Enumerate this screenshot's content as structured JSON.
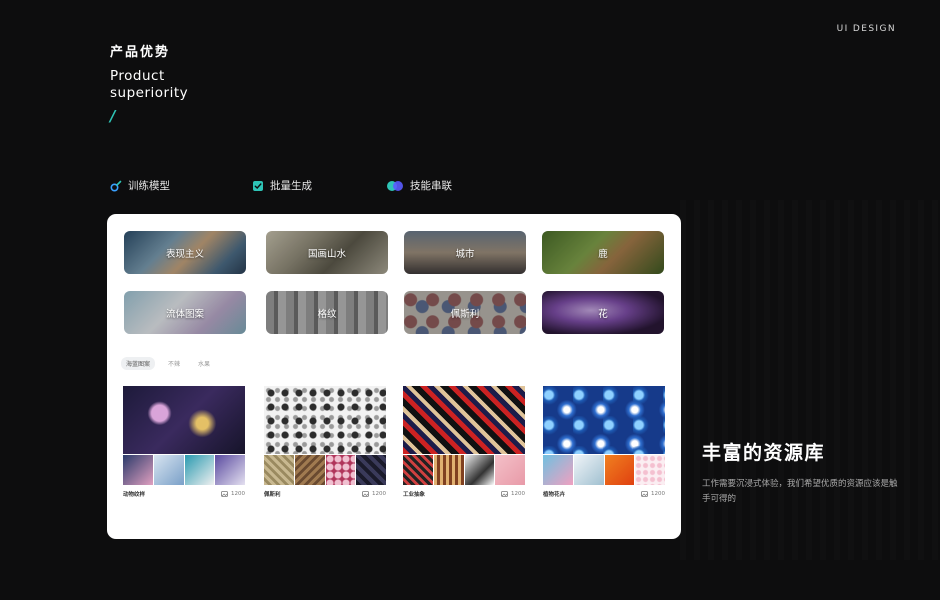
{
  "brand_tag": "UI DESIGN",
  "header": {
    "title_cn": "产品优势",
    "title_en_line1": "Product",
    "title_en_line2": "superiority",
    "slash": "/"
  },
  "features": [
    {
      "label": "训练模型",
      "icon": "model-training-icon"
    },
    {
      "label": "批量生成",
      "icon": "checkbox-icon"
    },
    {
      "label": "技能串联",
      "icon": "toggle-dots-icon"
    }
  ],
  "categories": [
    {
      "label": "表现主义"
    },
    {
      "label": "国画山水"
    },
    {
      "label": "城市"
    },
    {
      "label": "鹿"
    },
    {
      "label": "流体图案"
    },
    {
      "label": "格纹"
    },
    {
      "label": "佩斯利"
    },
    {
      "label": "花"
    }
  ],
  "tabs": [
    "海蓝图案",
    "不辣",
    "水果"
  ],
  "cards": [
    {
      "name": "动物纹样",
      "count": "1200"
    },
    {
      "name": "佩斯利",
      "count": "1200"
    },
    {
      "name": "工业抽象",
      "count": "1200"
    },
    {
      "name": "植物花卉",
      "count": "1200"
    }
  ],
  "side": {
    "title": "丰富的资源库",
    "desc": "工作需要沉浸式体验，我们希望优质的资源应该是触手可得的"
  },
  "colors": {
    "background": "#0d0d0e",
    "accent": "#2ec4b6",
    "panel": "#ffffff"
  }
}
